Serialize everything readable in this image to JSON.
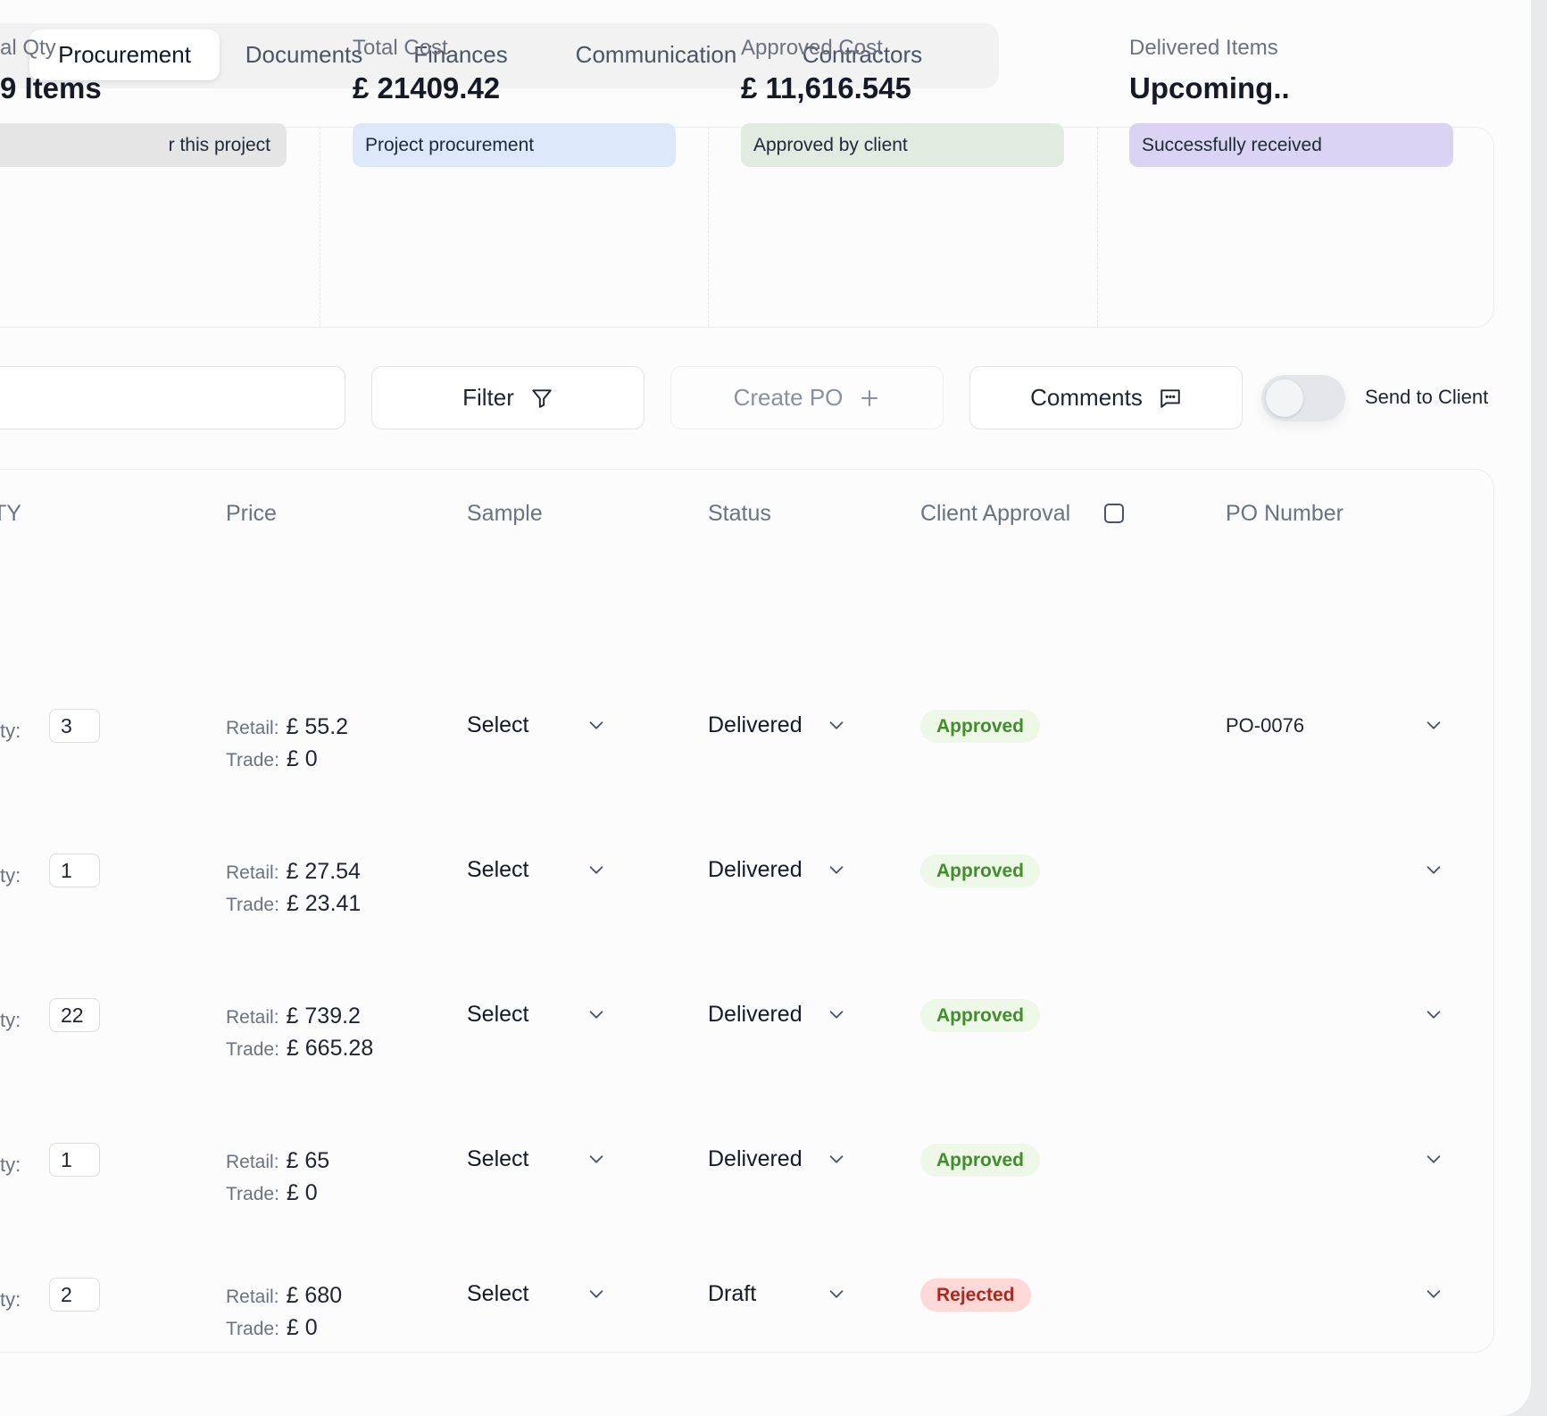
{
  "tabs": [
    {
      "label": "Procurement",
      "active": true
    },
    {
      "label": "Documents"
    },
    {
      "label": "Finances"
    },
    {
      "label": "Communication"
    },
    {
      "label": "Contractors"
    }
  ],
  "stats": [
    {
      "label": "al Qty",
      "value": "9 Items",
      "badge": "r this project",
      "badge_color": "#e5e5e5"
    },
    {
      "label": "Total Cost",
      "value": "£ 21409.42",
      "badge": "Project procurement",
      "badge_color": "#dbe9fa"
    },
    {
      "label": "Approved Cost",
      "value": "£ 11,616.545",
      "badge": "Approved by client",
      "badge_color": "#e1ebe0"
    },
    {
      "label": "Delivered Items",
      "value": "Upcoming..",
      "badge": "Successfully received",
      "badge_color": "#dad3f4"
    }
  ],
  "toolbar": {
    "search_value": "",
    "filter_label": "Filter",
    "create_po_label": "Create PO",
    "comments_label": "Comments",
    "send_to_client_label": "Send to Client",
    "send_to_client_on": false
  },
  "table": {
    "headers": {
      "qty": "TY",
      "price": "Price",
      "sample": "Sample",
      "status": "Status",
      "client_approval": "Client Approval",
      "po_number": "PO Number"
    },
    "qty_label": "ty:",
    "retail_label": "Retail:",
    "trade_label": "Trade:",
    "rows": [
      {
        "qty": "3",
        "retail": "£ 55.2",
        "trade": "£ 0",
        "sample": "Select",
        "status": "Delivered",
        "approval": "Approved",
        "approval_kind": "approved",
        "po": "PO-0076"
      },
      {
        "qty": "1",
        "retail": "£ 27.54",
        "trade": "£ 23.41",
        "sample": "Select",
        "status": "Delivered",
        "approval": "Approved",
        "approval_kind": "approved",
        "po": ""
      },
      {
        "qty": "22",
        "retail": "£ 739.2",
        "trade": "£ 665.28",
        "sample": "Select",
        "status": "Delivered",
        "approval": "Approved",
        "approval_kind": "approved",
        "po": ""
      },
      {
        "qty": "1",
        "retail": "£ 65",
        "trade": "£ 0",
        "sample": "Select",
        "status": "Delivered",
        "approval": "Approved",
        "approval_kind": "approved",
        "po": ""
      },
      {
        "qty": "2",
        "retail": "£ 680",
        "trade": "£ 0",
        "sample": "Select",
        "status": "Draft",
        "approval": "Rejected",
        "approval_kind": "rejected",
        "po": ""
      }
    ]
  }
}
